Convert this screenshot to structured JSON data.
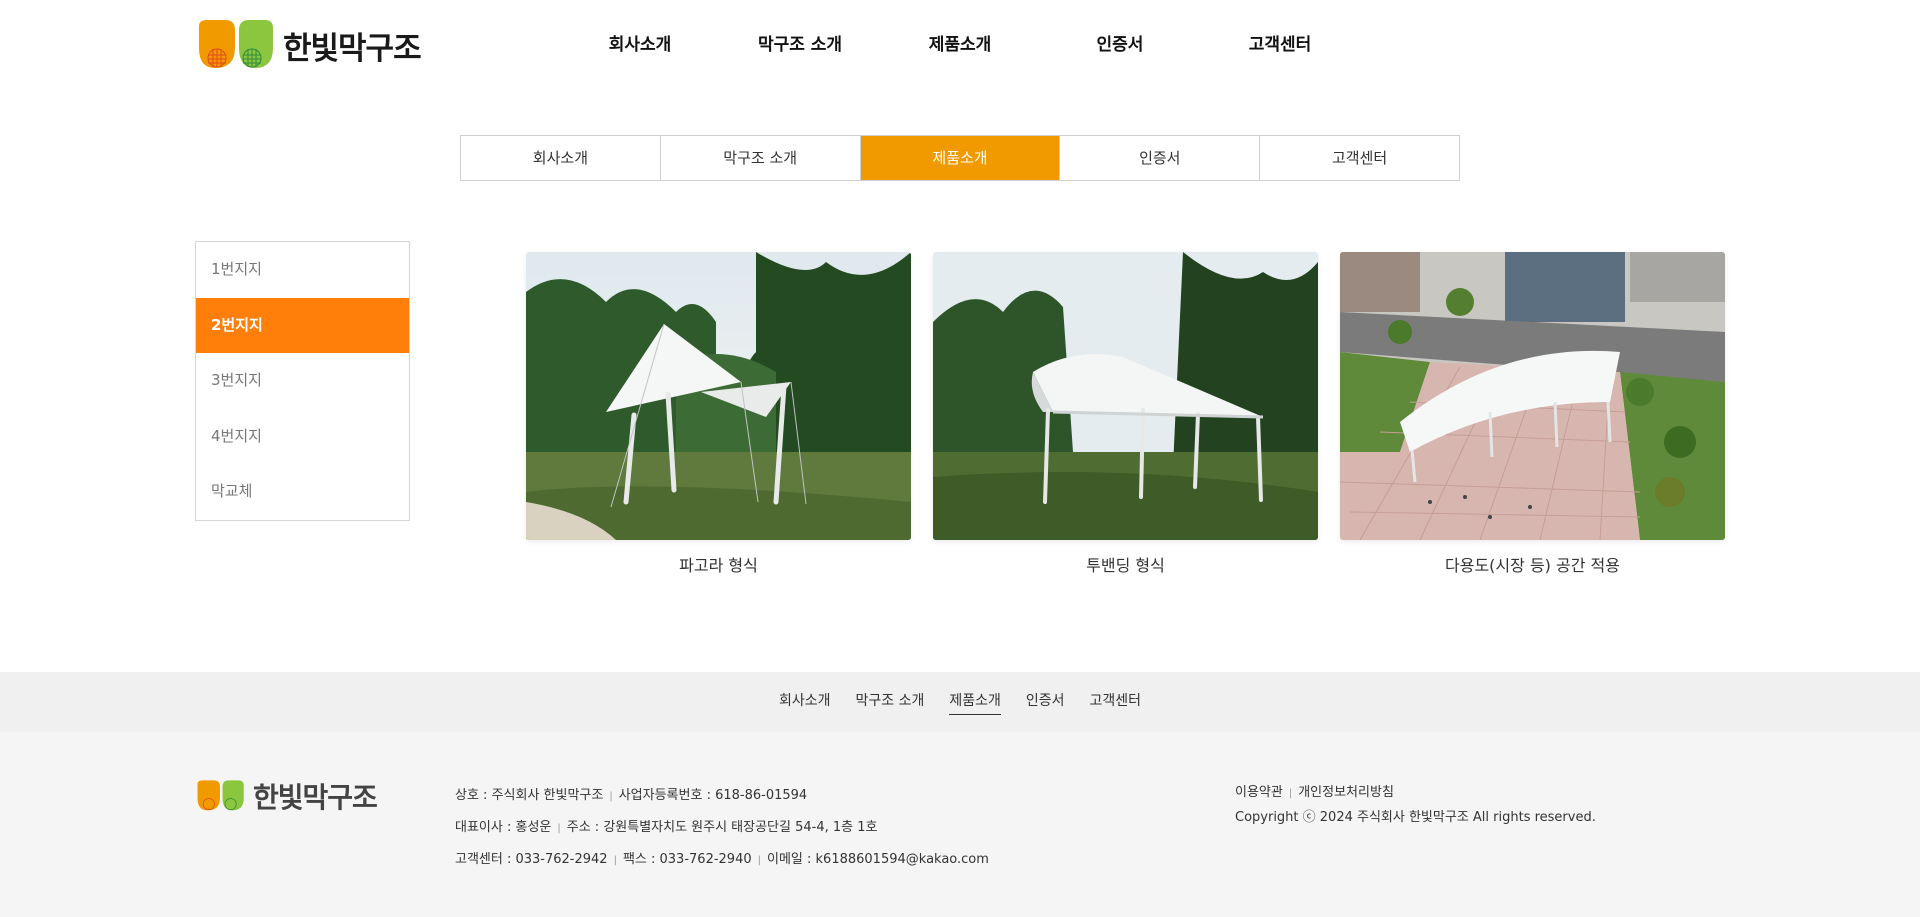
{
  "brand": {
    "name": "한빛막구조",
    "colors": {
      "orange": "#f09a00",
      "green": "#8cc63f",
      "accent": "#ff7f0a"
    }
  },
  "gnb": [
    "회사소개",
    "막구조 소개",
    "제품소개",
    "인증서",
    "고객센터"
  ],
  "subtabs": {
    "items": [
      "회사소개",
      "막구조 소개",
      "제품소개",
      "인증서",
      "고객센터"
    ],
    "active": "제품소개"
  },
  "sidemenu": {
    "items": [
      "1번지지",
      "2번지지",
      "3번지지",
      "4번지지",
      "막교체"
    ],
    "active": "2번지지"
  },
  "gallery": [
    {
      "caption": "파고라 형식",
      "image": "tent-pergola-park"
    },
    {
      "caption": "투밴딩 형식",
      "image": "canopy-arch-park"
    },
    {
      "caption": "다용도(시장 등) 공간 적용",
      "image": "canopy-plaza-aerial"
    }
  ],
  "footer_nav": {
    "items": [
      "회사소개",
      "막구조 소개",
      "제품소개",
      "인증서",
      "고객센터"
    ],
    "active": "제품소개"
  },
  "footer": {
    "company": "상호 : 주식회사 한빛막구조",
    "bizno": "사업자등록번호 : 618-86-01594",
    "ceo": "대표이사 : 홍성운",
    "address": "주소 : 강원특별자치도 원주시 태장공단길 54-4, 1층 1호",
    "tel": "고객센터 : 033-762-2942",
    "fax": "팩스 : 033-762-2940",
    "email": "이메일 : k6188601594@kakao.com",
    "terms": "이용약관",
    "privacy": "개인정보처리방침",
    "copyright": "Copyright ⓒ 2024 주식회사 한빛막구조 All rights reserved."
  }
}
